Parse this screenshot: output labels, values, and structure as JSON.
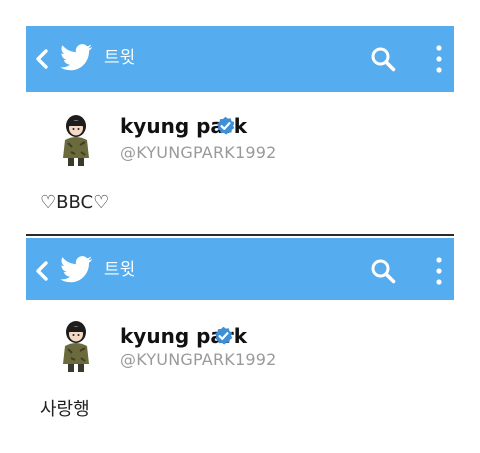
{
  "screens": [
    {
      "header": {
        "title": "트윗"
      },
      "author": {
        "display_name": "kyung park",
        "handle": "@KYUNGPARK1992"
      },
      "tweet": {
        "text": "♡BBC♡"
      }
    },
    {
      "header": {
        "title": "트윗"
      },
      "author": {
        "display_name": "kyung park",
        "handle": "@KYUNGPARK1992"
      },
      "tweet": {
        "text": "사랑행"
      }
    }
  ],
  "icons": {
    "back": "chevron-left-icon",
    "brand": "twitter-bird-icon",
    "search": "search-icon",
    "more": "more-vertical-icon",
    "verified": "verified-badge-icon"
  },
  "colors": {
    "appbar": "#55acee",
    "verified": "#3f8fd6",
    "handle": "#9a9a9a"
  }
}
